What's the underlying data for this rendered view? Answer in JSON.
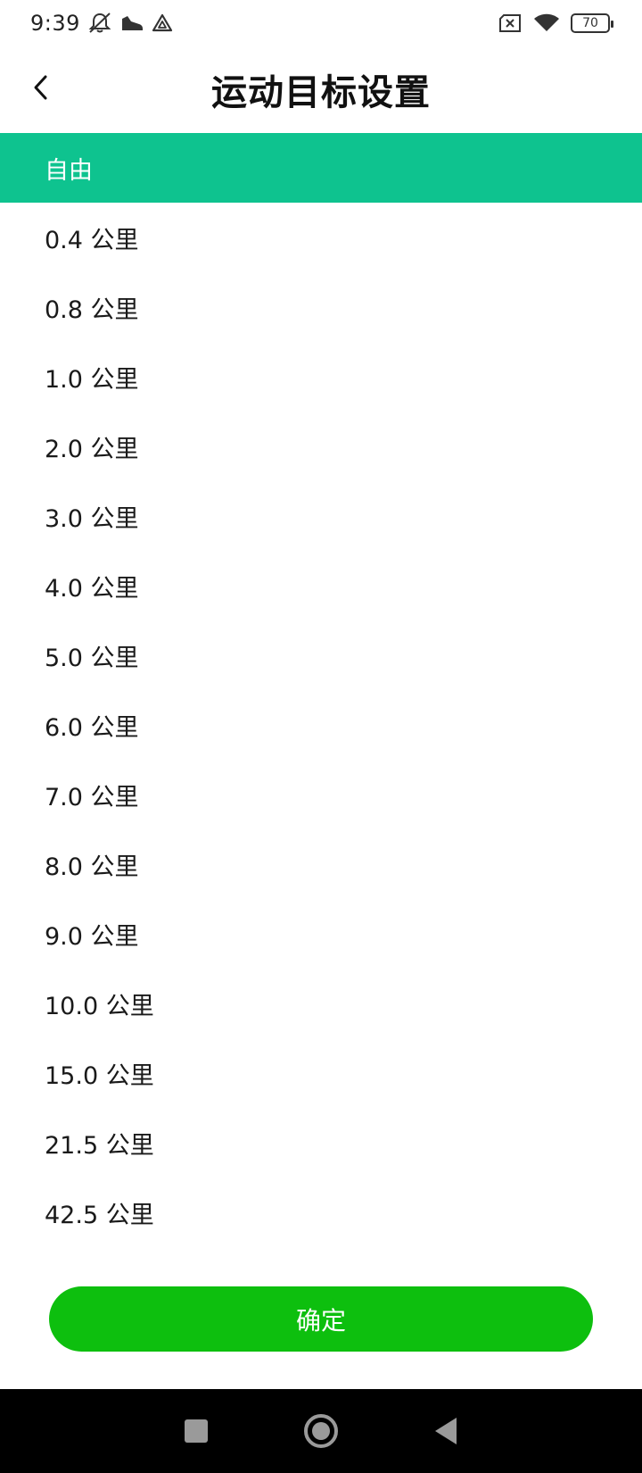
{
  "status_bar": {
    "time": "9:39",
    "left_icons": [
      "mute-icon",
      "sneaker-icon",
      "drive-icon"
    ],
    "right_icons": [
      "no-sim-icon",
      "wifi-icon",
      "battery-icon"
    ],
    "battery_level": "70"
  },
  "header": {
    "title": "运动目标设置",
    "back_icon": "chevron-left-icon"
  },
  "options": [
    {
      "label": "自由",
      "selected": true
    },
    {
      "label": "0.4 公里",
      "selected": false
    },
    {
      "label": "0.8 公里",
      "selected": false
    },
    {
      "label": "1.0 公里",
      "selected": false
    },
    {
      "label": "2.0 公里",
      "selected": false
    },
    {
      "label": "3.0 公里",
      "selected": false
    },
    {
      "label": "4.0 公里",
      "selected": false
    },
    {
      "label": "5.0 公里",
      "selected": false
    },
    {
      "label": "6.0 公里",
      "selected": false
    },
    {
      "label": "7.0 公里",
      "selected": false
    },
    {
      "label": "8.0 公里",
      "selected": false
    },
    {
      "label": "9.0 公里",
      "selected": false
    },
    {
      "label": "10.0 公里",
      "selected": false
    },
    {
      "label": "15.0 公里",
      "selected": false
    },
    {
      "label": "21.5 公里",
      "selected": false
    },
    {
      "label": "42.5 公里",
      "selected": false
    }
  ],
  "confirm_button": {
    "label": "确定"
  },
  "colors": {
    "selected_row": "#0ec38f",
    "confirm_button": "#0dbf0e",
    "system_nav": "#000000"
  },
  "system_nav": {
    "buttons": [
      "recents-square-icon",
      "home-circle-icon",
      "back-triangle-icon"
    ]
  }
}
